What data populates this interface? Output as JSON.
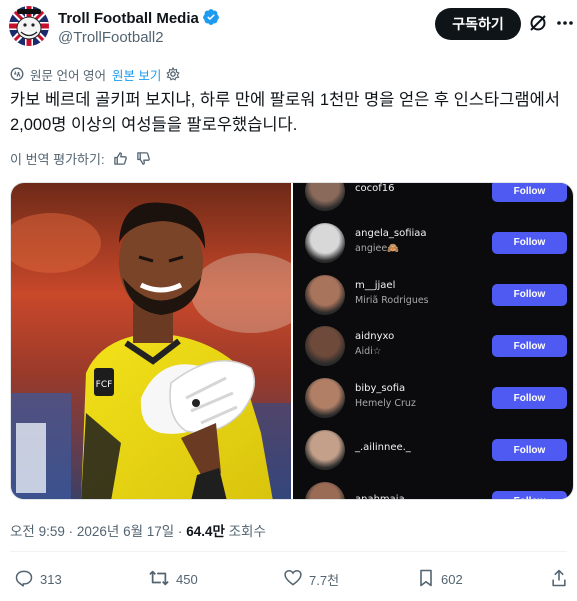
{
  "author": {
    "name": "Troll Football Media",
    "handle": "@TrollFootball2",
    "verified": true,
    "avatar_icon": "troll-face-avatar"
  },
  "header": {
    "subscribe_label": "구독하기",
    "grok_icon": "grok-icon",
    "more_icon": "more-icon"
  },
  "translation": {
    "label": "원문 언어 영어",
    "show_original": "원본 보기",
    "settings_icon": "gear-icon"
  },
  "post": {
    "text": "카보 베르데 골키퍼 보지냐, 하루 만에 팔로워 1천만 명을 얻은 후 인스타그램에서 2,000명 이상의 여성들을 팔로우했습니다."
  },
  "rate_translation": {
    "label": "이 번역 평가하기:"
  },
  "media": {
    "right_image": {
      "rows": [
        {
          "username": "cocof16",
          "name": "",
          "follow_label": "Follow"
        },
        {
          "username": "angela_sofiiaa",
          "name": "angiee🙈",
          "follow_label": "Follow"
        },
        {
          "username": "m__jjael",
          "name": "Miriã Rodrigues",
          "follow_label": "Follow"
        },
        {
          "username": "aidnyxo",
          "name": "Aidi☆",
          "follow_label": "Follow"
        },
        {
          "username": "biby_sofia",
          "name": "Hemely Cruz",
          "follow_label": "Follow"
        },
        {
          "username": "_.ailinnee._",
          "name": "",
          "follow_label": "Follow"
        },
        {
          "username": "anahmaia",
          "name": "",
          "follow_label": "Follow"
        }
      ]
    }
  },
  "meta": {
    "timestamp": "오전 9:59 · 2026년 6월 17일 · ",
    "views_count": "64.4만",
    "views_label": " 조회수"
  },
  "actions": {
    "replies": "313",
    "reposts": "450",
    "likes": "7.7천",
    "bookmarks": "602"
  },
  "colors": {
    "accent": "#1d9bf0",
    "follow_button": "#4f5af2",
    "secondary_text": "#536471"
  }
}
